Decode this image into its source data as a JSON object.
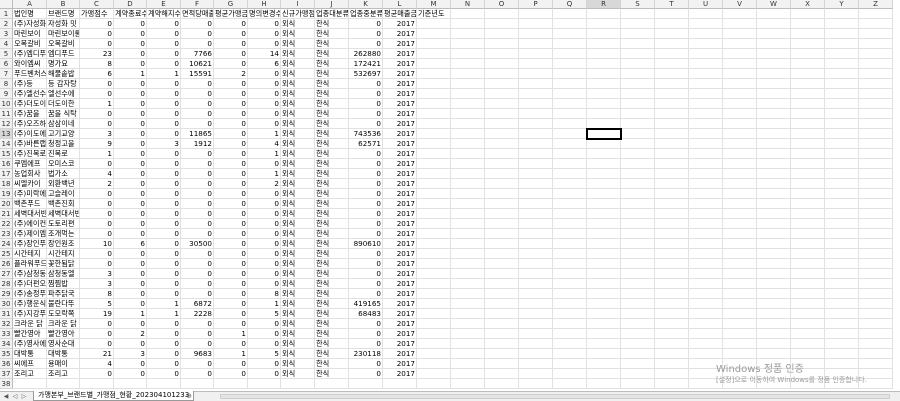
{
  "columns": [
    "A",
    "B",
    "C",
    "D",
    "E",
    "F",
    "G",
    "H",
    "I",
    "J",
    "K",
    "L",
    "M",
    "N",
    "O",
    "P",
    "Q",
    "R",
    "S",
    "T",
    "U",
    "V",
    "W",
    "X",
    "Y",
    "Z"
  ],
  "selected_column": "R",
  "selected_row": 13,
  "header_row": [
    "법인명",
    "브랜드명",
    "가맹점수",
    "계약종료수",
    "계약해지수",
    "면적당매출",
    "평균가맹금",
    "명의변경수",
    "신규가맹점",
    "업종대분류",
    "업종중분류",
    "평균매출금액",
    "기준년도"
  ],
  "rows": [
    [
      "(주)자성화",
      "자성화 밋",
      "0",
      "0",
      "0",
      "0",
      "0",
      "0",
      "외식",
      "한식",
      "0",
      "2017"
    ],
    [
      "마린보이",
      "마린보이롱",
      "0",
      "0",
      "0",
      "0",
      "0",
      "0",
      "외식",
      "한식",
      "0",
      "2017"
    ],
    [
      "오목갈비",
      "오목갈비",
      "0",
      "0",
      "0",
      "0",
      "0",
      "0",
      "외식",
      "한식",
      "0",
      "2017"
    ],
    [
      "(주)엠디푸",
      "엠디푸드",
      "23",
      "0",
      "0",
      "7766",
      "0",
      "14",
      "외식",
      "한식",
      "262880",
      "2017"
    ],
    [
      "와이엠씨",
      "명가요",
      "8",
      "0",
      "0",
      "10621",
      "0",
      "6",
      "외식",
      "한식",
      "172421",
      "2017"
    ],
    [
      "푸드벤처스",
      "해물솥밥",
      "6",
      "1",
      "1",
      "15591",
      "2",
      "0",
      "외식",
      "한식",
      "532697",
      "2017"
    ],
    [
      "(주)등",
      "등 감자탕",
      "0",
      "0",
      "0",
      "0",
      "0",
      "0",
      "외식",
      "한식",
      "0",
      "2017"
    ],
    [
      "(주)엘선수",
      "엘선수에",
      "0",
      "0",
      "0",
      "0",
      "0",
      "0",
      "외식",
      "한식",
      "0",
      "2017"
    ],
    [
      "(주)더도이",
      "더도이한",
      "1",
      "0",
      "0",
      "0",
      "0",
      "0",
      "외식",
      "한식",
      "0",
      "2017"
    ],
    [
      "(주)꿈을",
      "꿈을 식탁",
      "0",
      "0",
      "0",
      "0",
      "0",
      "0",
      "외식",
      "한식",
      "0",
      "2017"
    ],
    [
      "(주)오즈하",
      "삼삼이네",
      "0",
      "0",
      "0",
      "0",
      "0",
      "0",
      "외식",
      "한식",
      "0",
      "2017"
    ],
    [
      "(주)이도에",
      "고기교양",
      "3",
      "0",
      "0",
      "11865",
      "0",
      "1",
      "외식",
      "한식",
      "743536",
      "2017"
    ],
    [
      "(주)바른랩",
      "청정고을",
      "9",
      "0",
      "3",
      "1912",
      "0",
      "4",
      "외식",
      "한식",
      "62571",
      "2017"
    ],
    [
      "(주)진복로",
      "진복로",
      "1",
      "0",
      "0",
      "0",
      "0",
      "1",
      "외식",
      "한식",
      "0",
      "2017"
    ],
    [
      "쿠엠에프",
      "오미스코",
      "0",
      "0",
      "0",
      "0",
      "0",
      "0",
      "외식",
      "한식",
      "0",
      "2017"
    ],
    [
      "농업회사",
      "법가소",
      "4",
      "0",
      "0",
      "0",
      "0",
      "1",
      "외식",
      "한식",
      "0",
      "2017"
    ],
    [
      "씨엘카이",
      "외환백년",
      "2",
      "0",
      "0",
      "0",
      "0",
      "2",
      "외식",
      "한식",
      "0",
      "2017"
    ],
    [
      "(주)미락에",
      "고슬레이",
      "0",
      "0",
      "0",
      "0",
      "0",
      "0",
      "외식",
      "한식",
      "0",
      "2017"
    ],
    [
      "백촌푸드",
      "백촌진회",
      "0",
      "0",
      "0",
      "0",
      "0",
      "0",
      "외식",
      "한식",
      "0",
      "2017"
    ],
    [
      "세벽대서빈",
      "세벽대서빈",
      "0",
      "0",
      "0",
      "0",
      "0",
      "0",
      "외식",
      "한식",
      "0",
      "2017"
    ],
    [
      "(주)에이컨",
      "도토리편",
      "0",
      "0",
      "0",
      "0",
      "0",
      "0",
      "외식",
      "한식",
      "0",
      "2017"
    ],
    [
      "(주)제이엠",
      "조개먹는",
      "0",
      "0",
      "0",
      "0",
      "0",
      "0",
      "외식",
      "한식",
      "0",
      "2017"
    ],
    [
      "(주)장인푸",
      "장인원조",
      "10",
      "6",
      "0",
      "30500",
      "0",
      "0",
      "외식",
      "한식",
      "890610",
      "2017"
    ],
    [
      "시간테지",
      "시간테지",
      "0",
      "0",
      "0",
      "0",
      "0",
      "0",
      "외식",
      "한식",
      "0",
      "2017"
    ],
    [
      "플라워푸드",
      "꽃한됨닭",
      "0",
      "0",
      "0",
      "0",
      "0",
      "0",
      "외식",
      "한식",
      "0",
      "2017"
    ],
    [
      "(주)삼청동",
      "삼청동엘",
      "3",
      "0",
      "0",
      "0",
      "0",
      "0",
      "외식",
      "한식",
      "0",
      "2017"
    ],
    [
      "(주)더펀오",
      "찜찜밥",
      "3",
      "0",
      "0",
      "0",
      "0",
      "0",
      "외식",
      "한식",
      "0",
      "2017"
    ],
    [
      "(주)송정푸",
      "파주닭국",
      "8",
      "0",
      "0",
      "0",
      "0",
      "8",
      "외식",
      "한식",
      "0",
      "2017"
    ],
    [
      "(주)행운식",
      "불란다뚜",
      "5",
      "0",
      "1",
      "6872",
      "0",
      "1",
      "외식",
      "한식",
      "419165",
      "2017"
    ],
    [
      "(주)지강푸",
      "도모락쪽",
      "19",
      "1",
      "1",
      "2228",
      "0",
      "5",
      "외식",
      "한식",
      "68483",
      "2017"
    ],
    [
      "크라운 닭",
      "크라운 닭",
      "0",
      "0",
      "0",
      "0",
      "0",
      "0",
      "외식",
      "한식",
      "0",
      "2017"
    ],
    [
      "빨간영아",
      "빨간영아",
      "0",
      "2",
      "0",
      "0",
      "1",
      "0",
      "외식",
      "한식",
      "0",
      "2017"
    ],
    [
      "(주)영사에",
      "영사순대",
      "0",
      "0",
      "0",
      "0",
      "0",
      "0",
      "외식",
      "한식",
      "0",
      "2017"
    ],
    [
      "대박통",
      "대박통",
      "21",
      "3",
      "0",
      "9683",
      "1",
      "5",
      "외식",
      "한식",
      "230118",
      "2017"
    ],
    [
      "씨에프",
      "용매이",
      "4",
      "0",
      "0",
      "0",
      "0",
      "0",
      "외식",
      "한식",
      "0",
      "2017"
    ],
    [
      "조리고",
      "조리고",
      "0",
      "0",
      "0",
      "0",
      "0",
      "0",
      "외식",
      "한식",
      "0",
      "2017"
    ]
  ],
  "sheet_tab": "가맹본부_브랜드별_가맹점_현황_202304101233",
  "watermark": {
    "line1": "Windows 정품 인증",
    "line2": "[설정]으로 이동하여 Windows를 정품 인증합니다."
  }
}
